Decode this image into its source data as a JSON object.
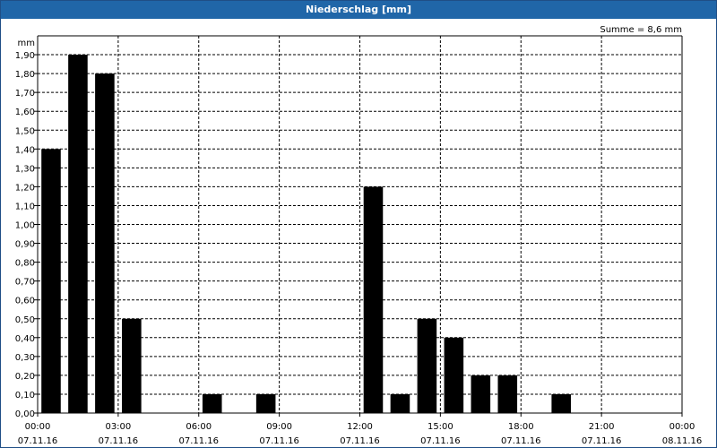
{
  "window": {
    "title": "Niederschlag [mm]"
  },
  "chart_data": {
    "type": "bar",
    "title": "Niederschlag [mm]",
    "ylabel": "mm",
    "annotation": "Summe = 8,6 mm",
    "ylim": [
      0,
      2.0
    ],
    "yticks": [
      "0,00",
      "0,10",
      "0,20",
      "0,30",
      "0,40",
      "0,50",
      "0,60",
      "0,70",
      "0,80",
      "0,90",
      "1,00",
      "1,10",
      "1,20",
      "1,30",
      "1,40",
      "1,50",
      "1,60",
      "1,70",
      "1,80",
      "1,90"
    ],
    "xlim": [
      0,
      24
    ],
    "xticks": [
      {
        "time": "00:00",
        "date": "07.11.16",
        "hour": 0
      },
      {
        "time": "03:00",
        "date": "07.11.16",
        "hour": 3
      },
      {
        "time": "06:00",
        "date": "07.11.16",
        "hour": 6
      },
      {
        "time": "09:00",
        "date": "07.11.16",
        "hour": 9
      },
      {
        "time": "12:00",
        "date": "07.11.16",
        "hour": 12
      },
      {
        "time": "15:00",
        "date": "07.11.16",
        "hour": 15
      },
      {
        "time": "18:00",
        "date": "07.11.16",
        "hour": 18
      },
      {
        "time": "21:00",
        "date": "07.11.16",
        "hour": 21
      },
      {
        "time": "00:00",
        "date": "08.11.16",
        "hour": 24
      }
    ],
    "hours": [
      0,
      1,
      2,
      3,
      4,
      5,
      6,
      7,
      8,
      9,
      10,
      11,
      12,
      13,
      14,
      15,
      16,
      17,
      18,
      19,
      20,
      21,
      22,
      23
    ],
    "values": [
      1.4,
      1.9,
      1.8,
      0.5,
      0,
      0,
      0.1,
      0,
      0.1,
      0,
      0,
      0,
      1.2,
      0.1,
      0.5,
      0.4,
      0.2,
      0.2,
      0,
      0.1,
      0,
      0,
      0,
      0
    ],
    "grid": true,
    "bar_color": "#000000",
    "grid_color": "#000000"
  }
}
